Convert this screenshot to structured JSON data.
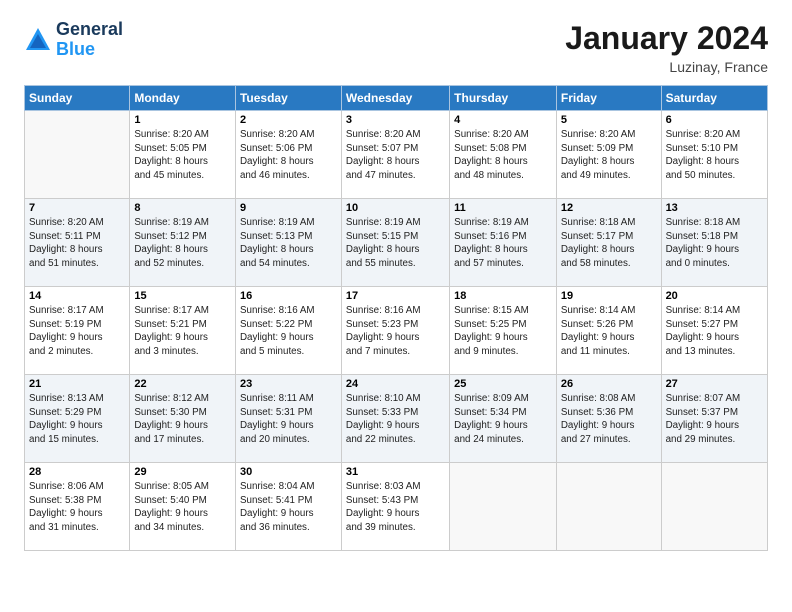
{
  "logo": {
    "text1": "General",
    "text2": "Blue"
  },
  "header": {
    "title": "January 2024",
    "subtitle": "Luzinay, France"
  },
  "columns": [
    "Sunday",
    "Monday",
    "Tuesday",
    "Wednesday",
    "Thursday",
    "Friday",
    "Saturday"
  ],
  "weeks": [
    [
      {
        "day": "",
        "info": ""
      },
      {
        "day": "1",
        "info": "Sunrise: 8:20 AM\nSunset: 5:05 PM\nDaylight: 8 hours\nand 45 minutes."
      },
      {
        "day": "2",
        "info": "Sunrise: 8:20 AM\nSunset: 5:06 PM\nDaylight: 8 hours\nand 46 minutes."
      },
      {
        "day": "3",
        "info": "Sunrise: 8:20 AM\nSunset: 5:07 PM\nDaylight: 8 hours\nand 47 minutes."
      },
      {
        "day": "4",
        "info": "Sunrise: 8:20 AM\nSunset: 5:08 PM\nDaylight: 8 hours\nand 48 minutes."
      },
      {
        "day": "5",
        "info": "Sunrise: 8:20 AM\nSunset: 5:09 PM\nDaylight: 8 hours\nand 49 minutes."
      },
      {
        "day": "6",
        "info": "Sunrise: 8:20 AM\nSunset: 5:10 PM\nDaylight: 8 hours\nand 50 minutes."
      }
    ],
    [
      {
        "day": "7",
        "info": "Sunrise: 8:20 AM\nSunset: 5:11 PM\nDaylight: 8 hours\nand 51 minutes."
      },
      {
        "day": "8",
        "info": "Sunrise: 8:19 AM\nSunset: 5:12 PM\nDaylight: 8 hours\nand 52 minutes."
      },
      {
        "day": "9",
        "info": "Sunrise: 8:19 AM\nSunset: 5:13 PM\nDaylight: 8 hours\nand 54 minutes."
      },
      {
        "day": "10",
        "info": "Sunrise: 8:19 AM\nSunset: 5:15 PM\nDaylight: 8 hours\nand 55 minutes."
      },
      {
        "day": "11",
        "info": "Sunrise: 8:19 AM\nSunset: 5:16 PM\nDaylight: 8 hours\nand 57 minutes."
      },
      {
        "day": "12",
        "info": "Sunrise: 8:18 AM\nSunset: 5:17 PM\nDaylight: 8 hours\nand 58 minutes."
      },
      {
        "day": "13",
        "info": "Sunrise: 8:18 AM\nSunset: 5:18 PM\nDaylight: 9 hours\nand 0 minutes."
      }
    ],
    [
      {
        "day": "14",
        "info": "Sunrise: 8:17 AM\nSunset: 5:19 PM\nDaylight: 9 hours\nand 2 minutes."
      },
      {
        "day": "15",
        "info": "Sunrise: 8:17 AM\nSunset: 5:21 PM\nDaylight: 9 hours\nand 3 minutes."
      },
      {
        "day": "16",
        "info": "Sunrise: 8:16 AM\nSunset: 5:22 PM\nDaylight: 9 hours\nand 5 minutes."
      },
      {
        "day": "17",
        "info": "Sunrise: 8:16 AM\nSunset: 5:23 PM\nDaylight: 9 hours\nand 7 minutes."
      },
      {
        "day": "18",
        "info": "Sunrise: 8:15 AM\nSunset: 5:25 PM\nDaylight: 9 hours\nand 9 minutes."
      },
      {
        "day": "19",
        "info": "Sunrise: 8:14 AM\nSunset: 5:26 PM\nDaylight: 9 hours\nand 11 minutes."
      },
      {
        "day": "20",
        "info": "Sunrise: 8:14 AM\nSunset: 5:27 PM\nDaylight: 9 hours\nand 13 minutes."
      }
    ],
    [
      {
        "day": "21",
        "info": "Sunrise: 8:13 AM\nSunset: 5:29 PM\nDaylight: 9 hours\nand 15 minutes."
      },
      {
        "day": "22",
        "info": "Sunrise: 8:12 AM\nSunset: 5:30 PM\nDaylight: 9 hours\nand 17 minutes."
      },
      {
        "day": "23",
        "info": "Sunrise: 8:11 AM\nSunset: 5:31 PM\nDaylight: 9 hours\nand 20 minutes."
      },
      {
        "day": "24",
        "info": "Sunrise: 8:10 AM\nSunset: 5:33 PM\nDaylight: 9 hours\nand 22 minutes."
      },
      {
        "day": "25",
        "info": "Sunrise: 8:09 AM\nSunset: 5:34 PM\nDaylight: 9 hours\nand 24 minutes."
      },
      {
        "day": "26",
        "info": "Sunrise: 8:08 AM\nSunset: 5:36 PM\nDaylight: 9 hours\nand 27 minutes."
      },
      {
        "day": "27",
        "info": "Sunrise: 8:07 AM\nSunset: 5:37 PM\nDaylight: 9 hours\nand 29 minutes."
      }
    ],
    [
      {
        "day": "28",
        "info": "Sunrise: 8:06 AM\nSunset: 5:38 PM\nDaylight: 9 hours\nand 31 minutes."
      },
      {
        "day": "29",
        "info": "Sunrise: 8:05 AM\nSunset: 5:40 PM\nDaylight: 9 hours\nand 34 minutes."
      },
      {
        "day": "30",
        "info": "Sunrise: 8:04 AM\nSunset: 5:41 PM\nDaylight: 9 hours\nand 36 minutes."
      },
      {
        "day": "31",
        "info": "Sunrise: 8:03 AM\nSunset: 5:43 PM\nDaylight: 9 hours\nand 39 minutes."
      },
      {
        "day": "",
        "info": ""
      },
      {
        "day": "",
        "info": ""
      },
      {
        "day": "",
        "info": ""
      }
    ]
  ]
}
